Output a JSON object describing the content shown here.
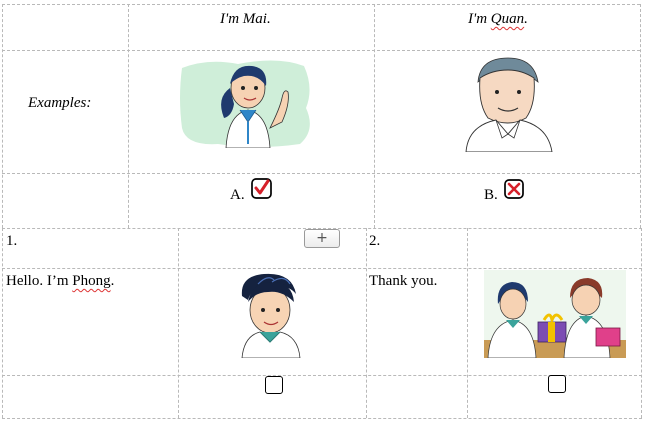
{
  "header": {
    "mai": "I'm Mai.",
    "quan_prefix": "I'm ",
    "quan_name": "Quan",
    "quan_suffix": "."
  },
  "examples": {
    "label": "Examples:",
    "option_a": "A.",
    "option_b": "B.",
    "a_icon": "checked-box-icon",
    "b_icon": "crossed-box-icon"
  },
  "row1": {
    "num1": "1.",
    "num2": "2.",
    "plus": "+"
  },
  "row2": {
    "text1_prefix": "Hello. I’m ",
    "text1_name": "Phong",
    "text1_suffix": ".",
    "text2": "Thank you."
  },
  "colors": {
    "check": "#d6202a",
    "grid": "#b9b9b9"
  }
}
